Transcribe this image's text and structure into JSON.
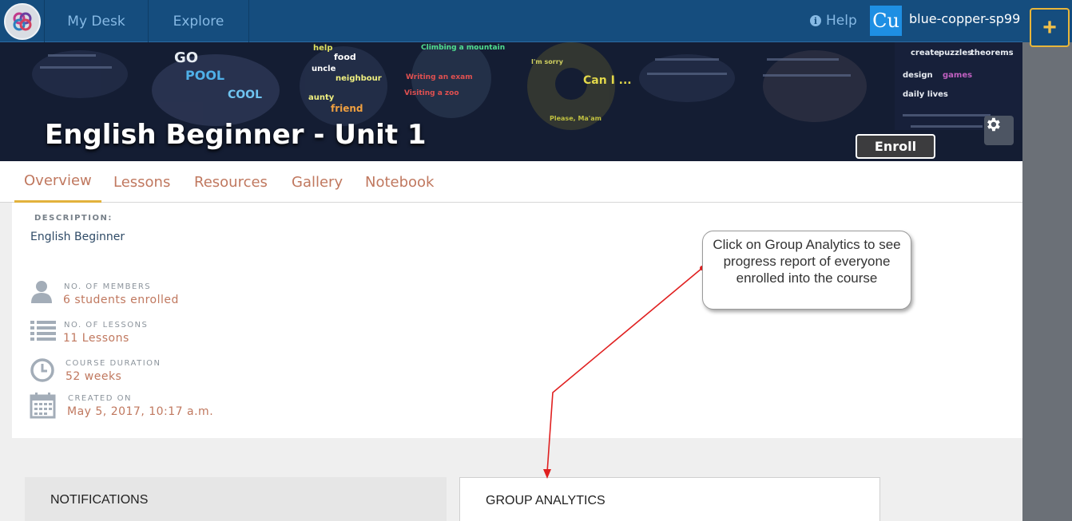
{
  "nav": {
    "tabs": [
      "My Desk",
      "Explore"
    ],
    "help_label": "Help",
    "avatar_initials": "Cu",
    "username": "blue-copper-sp99",
    "add_icon": "plus-icon"
  },
  "banner": {
    "course_title": "English Beginner - Unit 1",
    "enroll_label": "Enroll",
    "settings_icon": "gear-icon",
    "artwork_words": [
      "GO",
      "POOL",
      "COOL",
      "Can I ...",
      "help",
      "food",
      "uncle",
      "aunty",
      "friend",
      "neighbour",
      "Climbing a mountain",
      "Writing an exam",
      "Visiting a zoo",
      "I'm sorry",
      "Please, Ma'am",
      "create",
      "puzzles",
      "theorems",
      "design",
      "games",
      "daily lives"
    ]
  },
  "tabs": {
    "items": [
      "Overview",
      "Lessons",
      "Resources",
      "Gallery",
      "Notebook"
    ],
    "active": "Overview"
  },
  "overview": {
    "description_label": "DESCRIPTION:",
    "description_value": "English Beginner",
    "stats": [
      {
        "label": "NO. OF MEMBERS",
        "value": "6 students enrolled",
        "icon": "user-icon"
      },
      {
        "label": "NO. OF LESSONS",
        "value": "11 Lessons",
        "icon": "list-icon"
      },
      {
        "label": "COURSE DURATION",
        "value": "52 weeks",
        "icon": "clock-icon"
      },
      {
        "label": "CREATED ON",
        "value": "May 5, 2017, 10:17 a.m.",
        "icon": "calendar-icon"
      }
    ]
  },
  "callout": {
    "text": "Click on Group Analytics to see progress report of everyone enrolled into the course"
  },
  "cards": {
    "notifications_title": "NOTIFICATIONS",
    "group_analytics_title": "GROUP ANALYTICS"
  },
  "colors": {
    "topbar": "#154d7e",
    "nav_text": "#86b9e4",
    "accent_tab": "#e2b23c",
    "link_text": "#c0785f",
    "callout_arrow": "#e02020"
  }
}
